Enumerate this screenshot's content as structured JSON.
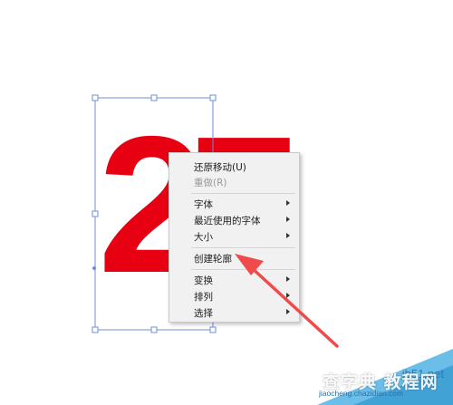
{
  "artwork": {
    "text": "27",
    "color": "#e60012"
  },
  "selection": {
    "color": "#6f8fd8"
  },
  "context_menu": {
    "items": [
      {
        "label": "还原移动(U)",
        "has_submenu": false,
        "disabled": false
      },
      {
        "label": "重做(R)",
        "has_submenu": false,
        "disabled": true
      },
      {
        "label": "字体",
        "has_submenu": true,
        "disabled": false
      },
      {
        "label": "最近使用的字体",
        "has_submenu": true,
        "disabled": false
      },
      {
        "label": "大小",
        "has_submenu": true,
        "disabled": false
      },
      {
        "label": "创建轮廓",
        "has_submenu": false,
        "disabled": false
      },
      {
        "label": "变换",
        "has_submenu": true,
        "disabled": false
      },
      {
        "label": "排列",
        "has_submenu": true,
        "disabled": false
      },
      {
        "label": "选择",
        "has_submenu": true,
        "disabled": false
      }
    ]
  },
  "annotation": {
    "color": "#f04a4a",
    "points_to": "创建轮廓"
  },
  "watermark": {
    "text_big": "查字典 教程网",
    "site": "jb51.net",
    "url": "jiaocheng.chazidian.com"
  }
}
